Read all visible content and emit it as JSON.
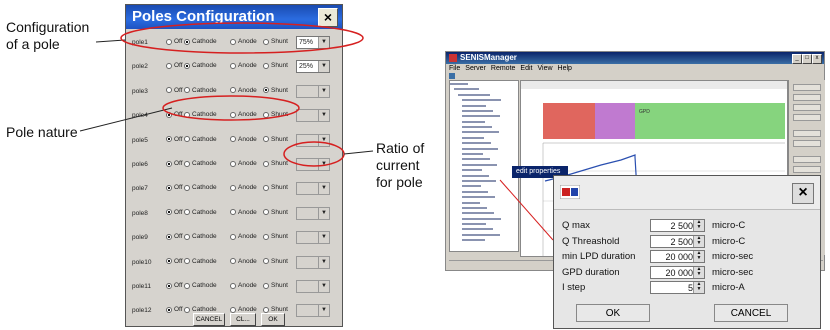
{
  "callouts": {
    "config_line1": "Configuration",
    "config_line2": "of a pole",
    "nature": "Pole nature",
    "ratio_line1": "Ratio of",
    "ratio_line2": "current",
    "ratio_line3": "for pole"
  },
  "poles_dialog": {
    "title": "Poles Configuration",
    "close": "×",
    "options": [
      "Off",
      "Cathode",
      "Anode",
      "Shunt"
    ],
    "rows": [
      {
        "label": "pole1",
        "selected": 1,
        "ratio": "75%",
        "enabled": true
      },
      {
        "label": "pole2",
        "selected": 1,
        "ratio": "25%",
        "enabled": true
      },
      {
        "label": "pole3",
        "selected": 3,
        "ratio": "",
        "enabled": false
      },
      {
        "label": "pole4",
        "selected": 0,
        "ratio": "",
        "enabled": false
      },
      {
        "label": "pole5",
        "selected": 0,
        "ratio": "",
        "enabled": false
      },
      {
        "label": "pole6",
        "selected": 0,
        "ratio": "",
        "enabled": false
      },
      {
        "label": "pole7",
        "selected": 0,
        "ratio": "",
        "enabled": false
      },
      {
        "label": "pole8",
        "selected": 0,
        "ratio": "",
        "enabled": false
      },
      {
        "label": "pole9",
        "selected": 0,
        "ratio": "",
        "enabled": false
      },
      {
        "label": "pole10",
        "selected": 0,
        "ratio": "",
        "enabled": false
      },
      {
        "label": "pole11",
        "selected": 0,
        "ratio": "",
        "enabled": false
      },
      {
        "label": "pole12",
        "selected": 0,
        "ratio": "",
        "enabled": false
      }
    ],
    "buttons": {
      "cancel": "CANCEL",
      "clear": "CL...",
      "ok": "OK"
    }
  },
  "manager": {
    "title": "SENISManager",
    "menu": [
      "File",
      "Server",
      "Remote",
      "Edit",
      "View",
      "Help"
    ],
    "context_menu_item": "edit properties",
    "plot_label": "GPD"
  },
  "edit_dialog": {
    "close": "×",
    "rows": [
      {
        "label": "Q max",
        "value": "2 500",
        "unit": "micro-C"
      },
      {
        "label": "Q Threashold",
        "value": "2 500",
        "unit": "micro-C"
      },
      {
        "label": "min LPD duration",
        "value": "20 000",
        "unit": "micro-sec"
      },
      {
        "label": "GPD duration",
        "value": "20 000",
        "unit": "micro-sec"
      },
      {
        "label": "I step",
        "value": "5",
        "unit": "micro-A"
      }
    ],
    "ok": "OK",
    "cancel": "CANCEL"
  },
  "colors": {
    "title_blue": "#1a4bb0",
    "annotation_red": "#d62020",
    "plot_red": "#e0665e",
    "plot_purple": "#c07ad0",
    "plot_green": "#86d47e",
    "plot_blue": "#2a4fb0"
  }
}
